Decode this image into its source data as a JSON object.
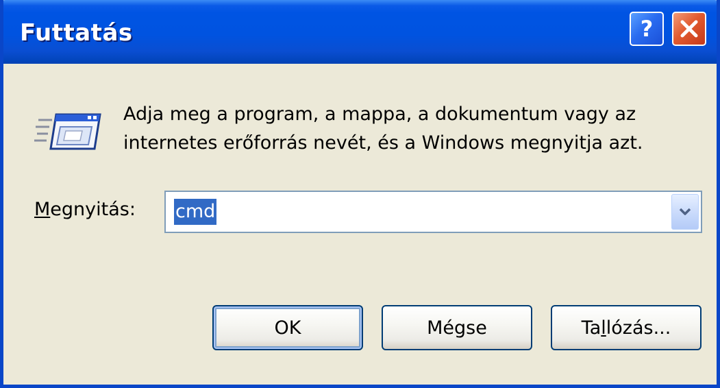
{
  "window": {
    "title": "Futtatás",
    "help_glyph": "?",
    "title_color": "#0054e3",
    "close_color": "#e25b30",
    "face_color": "#ece9d8"
  },
  "icons": {
    "help": "help-icon",
    "close": "close-icon",
    "run": "run-program-icon",
    "dropdown": "chevron-down-icon"
  },
  "prompt": {
    "text": "Adja meg a program, a mappa, a dokumentum vagy az\ninternetes erőforrás nevét, és a Windows megnyitja azt."
  },
  "open_field": {
    "label_mnemonic": "M",
    "label_rest": "egnyitás:",
    "value": "cmd",
    "selection_color": "#316ac5"
  },
  "buttons": {
    "ok": "OK",
    "cancel": "Mégse",
    "browse_pre": "Ta",
    "browse_mnemonic": "l",
    "browse_post": "lózás..."
  }
}
